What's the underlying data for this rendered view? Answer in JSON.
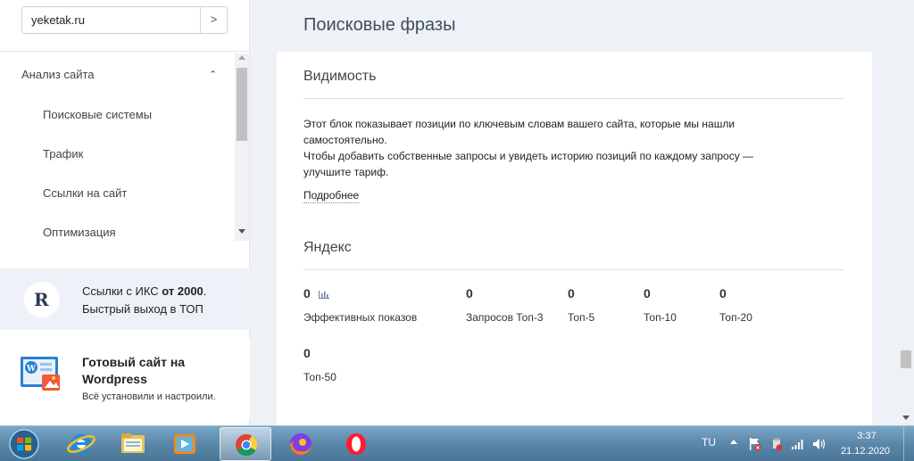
{
  "site_selector": {
    "value": "yeketak.ru",
    "go_label": ">"
  },
  "sidebar": {
    "group_label": "Анализ сайта",
    "items": [
      {
        "label": "Поисковые системы"
      },
      {
        "label": "Трафик"
      },
      {
        "label": "Ссылки на сайт"
      },
      {
        "label": "Оптимизация"
      }
    ]
  },
  "promo_links": {
    "line1_prefix": "Ссылки с ИКС ",
    "line1_bold": "от 2000",
    "line1_suffix": ".",
    "line2": "Быстрый выход в ТОП",
    "logo_letter": "R"
  },
  "promo_wordpress": {
    "title_line1": "Готовый сайт на",
    "title_line2": "Wordpress",
    "subtitle": "Всё установили и настроили."
  },
  "page": {
    "title": "Поисковые фразы"
  },
  "visibility": {
    "heading": "Видимость",
    "text_line1": "Этот блок показывает позиции по ключевым словам вашего сайта, которые мы нашли",
    "text_line2": "самостоятельно.",
    "text_line3": "Чтобы добавить собственные запросы и увидеть историю позиций по каждому запросу —",
    "text_line4": "улучшите тариф.",
    "more_link": "Подробнее"
  },
  "yandex": {
    "heading": "Яндекс",
    "stats": [
      {
        "value": "0",
        "label": "Эффективных показов"
      },
      {
        "value": "0",
        "label": "Запросов Топ-3"
      },
      {
        "value": "0",
        "label": "Топ-5"
      },
      {
        "value": "0",
        "label": "Топ-10"
      },
      {
        "value": "0",
        "label": "Топ-20"
      },
      {
        "value": "0",
        "label": "Топ-50"
      }
    ]
  },
  "taskbar": {
    "apps": [
      {
        "icon": "internet-explorer-icon"
      },
      {
        "icon": "file-explorer-icon"
      },
      {
        "icon": "media-player-icon"
      },
      {
        "icon": "chrome-icon"
      },
      {
        "icon": "firefox-icon"
      },
      {
        "icon": "opera-icon"
      }
    ],
    "language": "TU",
    "time": "3:37",
    "date": "21.12.2020"
  },
  "colors": {
    "accent": "#3f4d63",
    "sidebar_promo_bg": "#eef2f8",
    "page_bg": "#eef1f5"
  }
}
